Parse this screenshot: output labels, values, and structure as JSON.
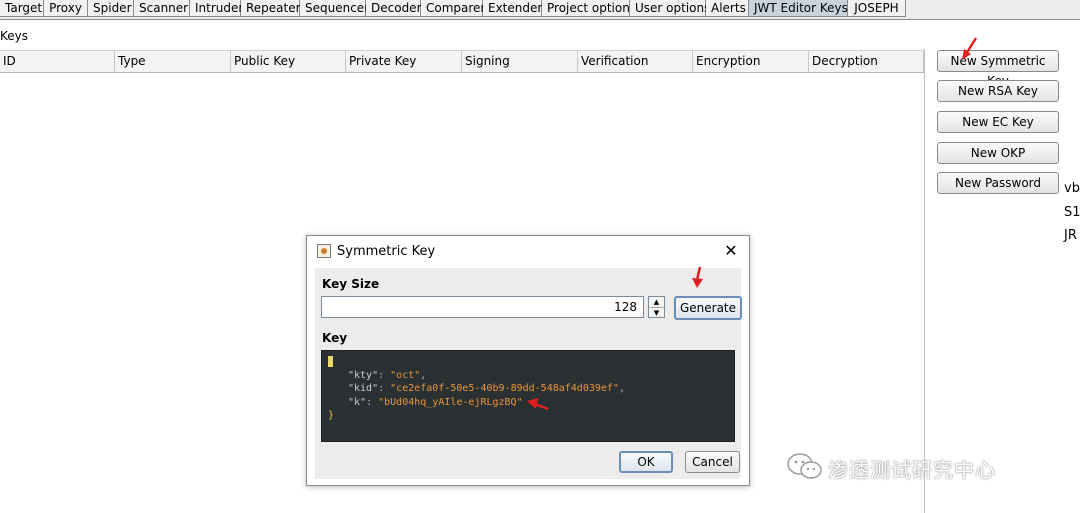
{
  "tabs": [
    "Target",
    "Proxy",
    "Spider",
    "Scanner",
    "Intruder",
    "Repeater",
    "Sequencer",
    "Decoder",
    "Comparer",
    "Extender",
    "Project options",
    "User options",
    "Alerts",
    "JWT Editor Keys",
    "JOSEPH"
  ],
  "active_tab": "JWT Editor Keys",
  "keys_label": "Keys",
  "table_columns": [
    "ID",
    "Type",
    "Public Key",
    "Private Key",
    "Signing",
    "Verification",
    "Encryption",
    "Decryption"
  ],
  "side_buttons": {
    "new_symmetric": "New Symmetric Key",
    "new_rsa": "New RSA Key",
    "new_ec": "New EC Key",
    "new_okp": "New OKP",
    "new_password": "New Password"
  },
  "edge_texts": [
    "vbl",
    "S1",
    "JR"
  ],
  "dialog": {
    "title": "Symmetric Key",
    "close_glyph": "✕",
    "key_size_label": "Key Size",
    "key_size_value": "128",
    "generate_label": "Generate",
    "key_label": "Key",
    "json": {
      "open": "{",
      "kty_key": "\"kty\"",
      "kty_val": "\"oct\"",
      "kid_key": "\"kid\"",
      "kid_val": "\"ce2efa0f-50e5-40b9-89dd-548af4d039ef\"",
      "k_key": "\"k\"",
      "k_val": "\"bUd04hq_yAIle-ejRLgzBQ\"",
      "close": "}"
    },
    "ok_label": "OK",
    "cancel_label": "Cancel"
  },
  "watermark": "渗透测试研究中心",
  "colors": {
    "active_tab": "#c9d3de",
    "code_bg": "#2b3033",
    "json_value": "#e8963a",
    "annotation_arrow": "#e02020"
  }
}
